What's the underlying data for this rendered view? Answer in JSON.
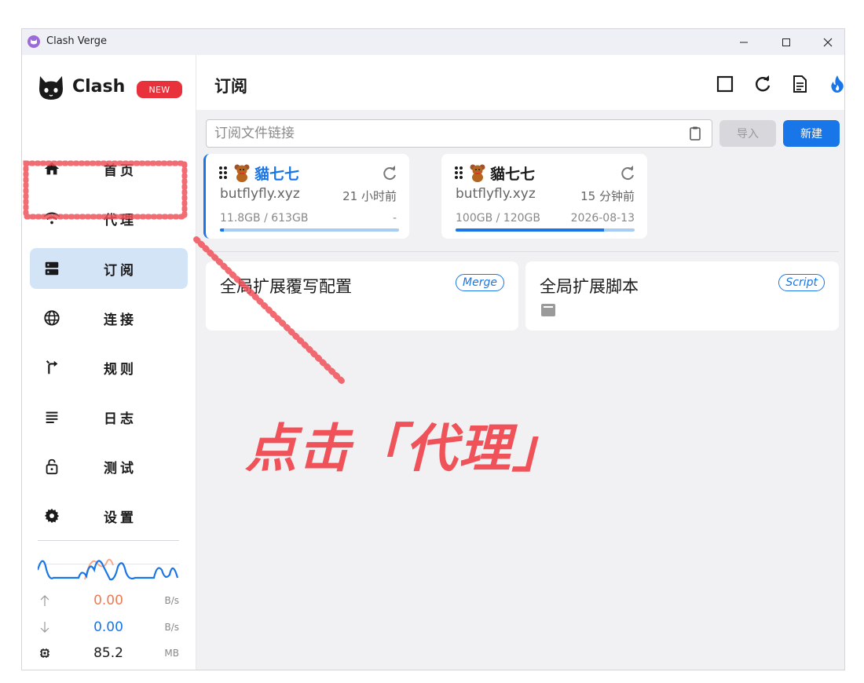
{
  "window": {
    "title": "Clash Verge"
  },
  "logo": {
    "text": "Clash V",
    "badge": "NEW"
  },
  "sidebar": {
    "items": [
      {
        "label": "首页",
        "icon": "home-icon"
      },
      {
        "label": "代理",
        "icon": "wifi-icon"
      },
      {
        "label": "订阅",
        "icon": "storage-icon",
        "active": true
      },
      {
        "label": "连接",
        "icon": "globe-icon"
      },
      {
        "label": "规则",
        "icon": "route-icon"
      },
      {
        "label": "日志",
        "icon": "list-icon"
      },
      {
        "label": "测试",
        "icon": "lock-icon"
      },
      {
        "label": "设置",
        "icon": "gear-icon"
      }
    ]
  },
  "traffic": {
    "upload": {
      "value": "0.00",
      "unit": "B/s",
      "color": "#f07a52"
    },
    "download": {
      "value": "0.00",
      "unit": "B/s",
      "color": "#1976e8"
    },
    "memory": {
      "value": "85.2",
      "unit": "MB"
    }
  },
  "header": {
    "title": "订阅"
  },
  "import": {
    "placeholder": "订阅文件链接",
    "import_label": "导入",
    "create_label": "新建"
  },
  "subscriptions": [
    {
      "name": "貓七七",
      "host": "butflyfly.xyz",
      "updated": "21 小时前",
      "usage": "11.8GB / 613GB",
      "expire": "-",
      "used_fraction": 0.02,
      "selected": true
    },
    {
      "name": "貓七七",
      "host": "butflyfly.xyz",
      "updated": "15 分钟前",
      "usage": "100GB / 120GB",
      "expire": "2026-08-13",
      "used_fraction": 0.83,
      "selected": false
    }
  ],
  "extensions": [
    {
      "title": "全局扩展覆写配置",
      "tag": "Merge"
    },
    {
      "title": "全局扩展脚本",
      "tag": "Script"
    }
  ],
  "annotation": {
    "text": "点击「代理」",
    "color": "#f0525a"
  }
}
